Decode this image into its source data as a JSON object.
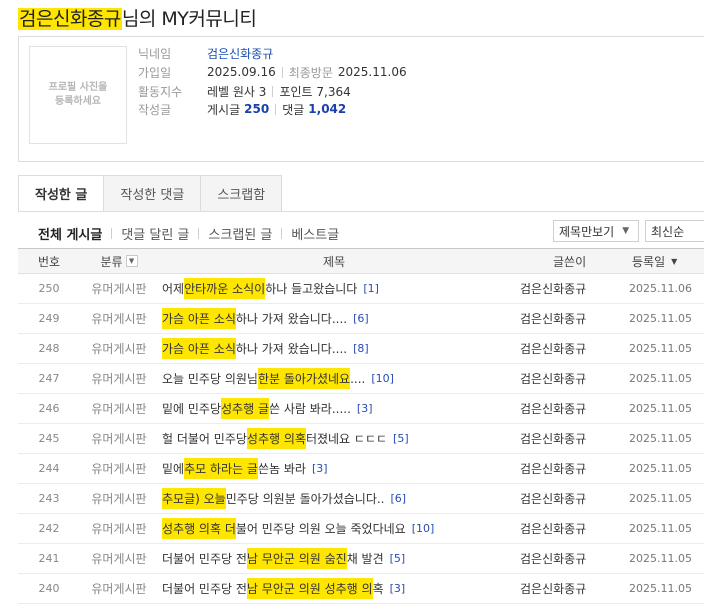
{
  "header": {
    "nickname": "검은신화종규",
    "title_suffix": "님의 MY커뮤니티"
  },
  "profile": {
    "photo_placeholder": [
      "프로필 사진을",
      "등록하세요"
    ],
    "nick_label": "닉네임",
    "nick_value": "검은신화종규",
    "joined_label": "가입일",
    "joined_value": "2025.09.16",
    "last_visit_label": "최종방문",
    "last_visit_value": "2025.11.06",
    "activity_label": "활동지수",
    "level_value": "레벨 원사 3",
    "point_value": "포인트 7,364",
    "posts_label": "작성글",
    "post_count_label": "게시글",
    "post_count": "250",
    "comment_count_label": "댓글",
    "comment_count": "1,042"
  },
  "tabs": [
    {
      "label": "작성한 글",
      "active": true
    },
    {
      "label": "작성한 댓글",
      "active": false
    },
    {
      "label": "스크랩함",
      "active": false
    }
  ],
  "filters": [
    {
      "label": "전체 게시글",
      "active": true
    },
    {
      "label": "댓글 달린 글",
      "active": false
    },
    {
      "label": "스크랩된 글",
      "active": false
    },
    {
      "label": "베스트글",
      "active": false
    }
  ],
  "view_select": "제목만보기",
  "order_select": "최신순",
  "columns": {
    "num": "번호",
    "category": "분류",
    "subject": "제목",
    "writer": "글쓴이",
    "date": "등록일"
  },
  "rows": [
    {
      "num": "250",
      "category": "유머게시판",
      "pre": "어제 ",
      "hl": "안타까운 소식이",
      "post": " 하나 들고왔습니다",
      "comments": "[1]",
      "writer": "검은신화종규",
      "date": "2025.11.06"
    },
    {
      "num": "249",
      "category": "유머게시판",
      "pre": "",
      "hl": "가슴 아픈 소식",
      "post": " 하나 가져 왔습니다....",
      "comments": "[6]",
      "writer": "검은신화종규",
      "date": "2025.11.05"
    },
    {
      "num": "248",
      "category": "유머게시판",
      "pre": "",
      "hl": "가슴 아픈 소식",
      "post": " 하나 가져 왔습니다....",
      "comments": "[8]",
      "writer": "검은신화종규",
      "date": "2025.11.05"
    },
    {
      "num": "247",
      "category": "유머게시판",
      "pre": "오늘 민주당 의원님",
      "hl": " 한분 돌아가셨네요",
      "post": "....",
      "comments": "[10]",
      "writer": "검은신화종규",
      "date": "2025.11.05"
    },
    {
      "num": "246",
      "category": "유머게시판",
      "pre": "밑에 민주당",
      "hl": " 성추행 글",
      "post": " 쓴 사람 봐라.....",
      "comments": "[3]",
      "writer": "검은신화종규",
      "date": "2025.11.05"
    },
    {
      "num": "245",
      "category": "유머게시판",
      "pre": "헐 더불어 민주당",
      "hl": " 성추행 의혹",
      "post": " 터졌네요 ㄷㄷㄷ",
      "comments": "[5]",
      "writer": "검은신화종규",
      "date": "2025.11.05"
    },
    {
      "num": "244",
      "category": "유머게시판",
      "pre": "밑에",
      "hl": " 추모 하라는 글",
      "post": " 쓴놈 봐라",
      "comments": "[3]",
      "writer": "검은신화종규",
      "date": "2025.11.05"
    },
    {
      "num": "243",
      "category": "유머게시판",
      "pre": "",
      "hl": "추모글) 오늘",
      "post": " 민주당 의원분 돌아가셨습니다..",
      "comments": "[6]",
      "writer": "검은신화종규",
      "date": "2025.11.05"
    },
    {
      "num": "242",
      "category": "유머게시판",
      "pre": "",
      "hl": "성추행 의혹 더",
      "post": "불어 민주당 의원 오늘 죽었다네요",
      "comments": "[10]",
      "writer": "검은신화종규",
      "date": "2025.11.05"
    },
    {
      "num": "241",
      "category": "유머게시판",
      "pre": "더불어 민주당 전",
      "hl": "남 무안군 의원 숨진",
      "post": "채 발견",
      "comments": "[5]",
      "writer": "검은신화종규",
      "date": "2025.11.05"
    },
    {
      "num": "240",
      "category": "유머게시판",
      "pre": "더불어 민주당 전",
      "hl": "남 무안군 의원 성추행 의",
      "post": "혹",
      "comments": "[3]",
      "writer": "검은신화종규",
      "date": "2025.11.05"
    }
  ]
}
